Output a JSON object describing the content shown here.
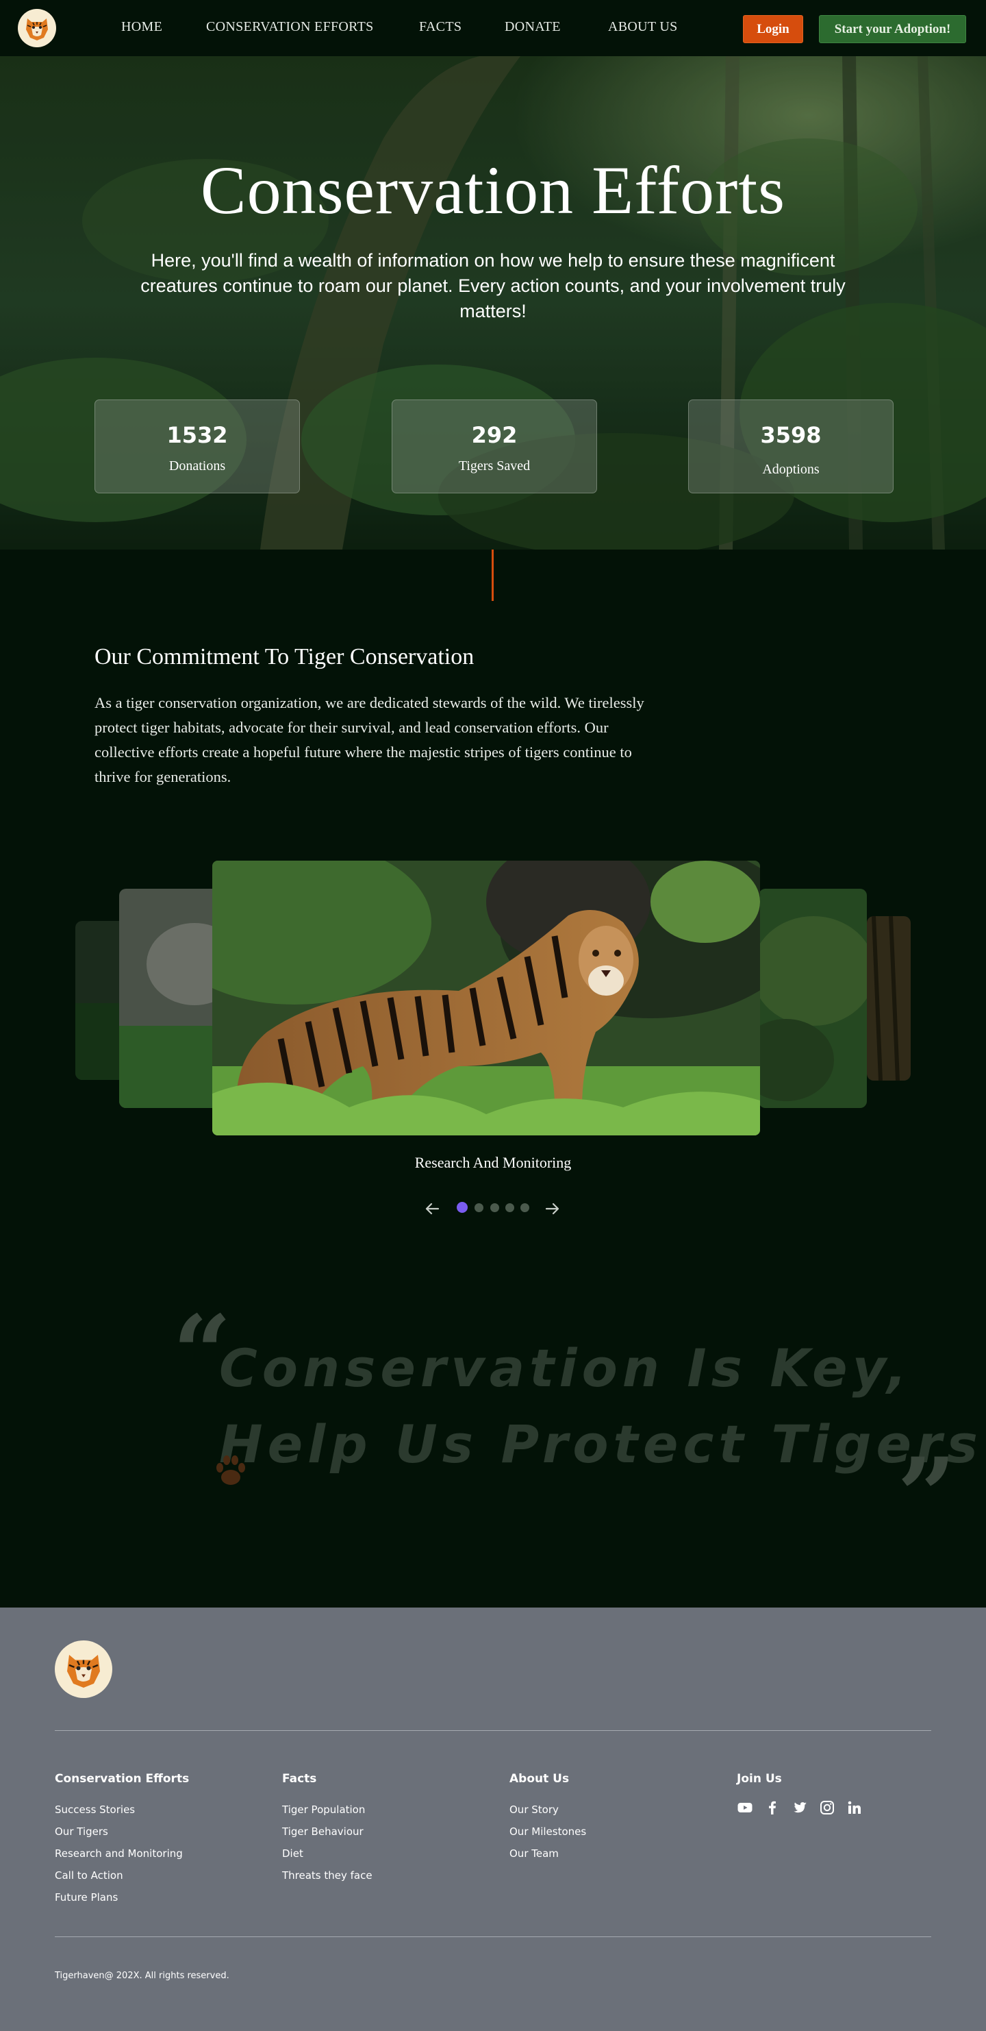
{
  "nav": {
    "links": [
      "HOME",
      "CONSERVATION EFFORTS",
      "FACTS",
      "DONATE",
      "ABOUT US"
    ],
    "login": "Login",
    "adopt": "Start your Adoption!"
  },
  "hero": {
    "title": "Conservation Efforts",
    "subtitle": "Here, you'll find a wealth of information on how we help to ensure these magnificent creatures continue to roam our planet. Every action counts, and your involvement truly matters!",
    "stats": [
      {
        "value": "1532",
        "label": "Donations"
      },
      {
        "value": "292",
        "label": "Tigers Saved"
      },
      {
        "value": "3598",
        "label": "Adoptions"
      }
    ]
  },
  "commitment": {
    "title": "Our Commitment To Tiger Conservation",
    "text": "As a tiger conservation organization, we are dedicated stewards of the wild. We tirelessly protect tiger habitats, advocate for their survival, and lead conservation efforts. Our collective efforts create a hopeful future where the majestic stripes of tigers continue to thrive for generations."
  },
  "carousel": {
    "caption": "Research And Monitoring",
    "slide_count": 5,
    "active_index": 0
  },
  "quote": {
    "line1": "Conservation Is Key,",
    "line2": "Help Us Protect Tigers"
  },
  "footer": {
    "columns": [
      {
        "title": "Conservation Efforts",
        "links": [
          "Success Stories",
          "Our Tigers",
          "Research and Monitoring",
          "Call to Action",
          "Future Plans"
        ]
      },
      {
        "title": "Facts",
        "links": [
          "Tiger Population",
          "Tiger Behaviour",
          "Diet",
          "Threats they face"
        ]
      },
      {
        "title": "About Us",
        "links": [
          "Our Story",
          "Our Milestones",
          "Our Team"
        ]
      },
      {
        "title": "Join Us",
        "links": []
      }
    ],
    "social_icons": [
      "youtube-icon",
      "facebook-icon",
      "twitter-icon",
      "instagram-icon",
      "linkedin-icon"
    ],
    "copyright": "Tigerhaven@ 202X. All rights reserved."
  },
  "colors": {
    "page_bg": "#031207",
    "accent_orange": "#d64d0d",
    "adopt_green": "#2c6b2f",
    "footer_bg": "#6b7079",
    "active_dot": "#7a5cf0"
  }
}
